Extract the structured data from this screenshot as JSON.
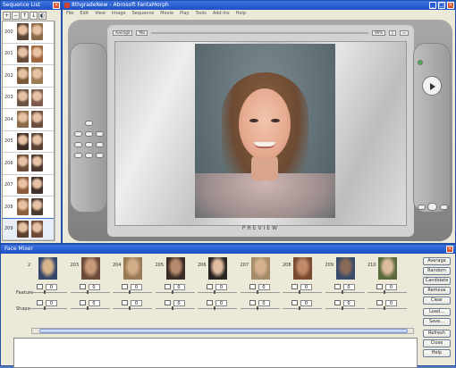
{
  "sequence_list": {
    "title": "Sequence List",
    "toolbar_buttons": [
      {
        "icon": "add-icon",
        "glyph": "+"
      },
      {
        "icon": "remove-icon",
        "glyph": "−"
      },
      {
        "icon": "move-up-icon",
        "glyph": "↑"
      },
      {
        "icon": "move-down-icon",
        "glyph": "↓"
      },
      {
        "icon": "sequence-settings-icon",
        "glyph": "◐"
      }
    ],
    "rows": [
      {
        "number": "200",
        "colors": [
          "#5b4636",
          "#8c6a4a"
        ]
      },
      {
        "number": "201",
        "colors": [
          "#6b4b3a",
          "#a0663d"
        ]
      },
      {
        "number": "202",
        "colors": [
          "#7a5a3b",
          "#9b7b55"
        ]
      },
      {
        "number": "203",
        "colors": [
          "#6b5343",
          "#7b5a49"
        ]
      },
      {
        "number": "204",
        "colors": [
          "#8a6a48",
          "#6c4d3c"
        ]
      },
      {
        "number": "205",
        "colors": [
          "#3b2c25",
          "#5b4435"
        ]
      },
      {
        "number": "206",
        "colors": [
          "#6c4e3a",
          "#4b3830"
        ]
      },
      {
        "number": "207",
        "colors": [
          "#8b5a3a",
          "#3f3029"
        ]
      },
      {
        "number": "208",
        "colors": [
          "#8a5e3f",
          "#4c3b33"
        ]
      },
      {
        "number": "209",
        "colors": [
          "#5b3f2f",
          "#6e4b38"
        ]
      }
    ]
  },
  "main_window": {
    "title": "8thgradeNew - Abrosoft FantaMorph",
    "menu": [
      "File",
      "Edit",
      "View",
      "Image",
      "Sequence",
      "Movie",
      "Play",
      "Tools",
      "Add-Ins",
      "Help"
    ],
    "screen_top": {
      "left_field": "Average",
      "mode": "Mix",
      "right_field": "90%"
    },
    "preview_label": "PREVIEW"
  },
  "face_mixer": {
    "title": "Face Mixer",
    "row_labels": {
      "feature": "Feature",
      "shape": "Shape"
    },
    "faces": [
      {
        "number": "2",
        "feature": "0",
        "shape": "0",
        "colors": [
          "#d8b58a",
          "#35466b"
        ]
      },
      {
        "number": "203",
        "feature": "0",
        "shape": "0",
        "colors": [
          "#c99a7a",
          "#6b4a3a"
        ]
      },
      {
        "number": "204",
        "feature": "0",
        "shape": "0",
        "colors": [
          "#d2ad88",
          "#9a7a55"
        ]
      },
      {
        "number": "205",
        "feature": "0",
        "shape": "0",
        "colors": [
          "#b68a6c",
          "#3b2c25"
        ]
      },
      {
        "number": "206",
        "feature": "0",
        "shape": "0",
        "colors": [
          "#e0bca0",
          "#272421"
        ]
      },
      {
        "number": "207",
        "feature": "0",
        "shape": "0",
        "colors": [
          "#d6b38e",
          "#a58b6a"
        ]
      },
      {
        "number": "208",
        "feature": "0",
        "shape": "0",
        "colors": [
          "#c08a6a",
          "#7a4a30"
        ]
      },
      {
        "number": "209",
        "feature": "0",
        "shape": "0",
        "colors": [
          "#8a6a58",
          "#3b4c6b"
        ]
      },
      {
        "number": "210",
        "feature": "0",
        "shape": "0",
        "colors": [
          "#dcbc9c",
          "#5a6b3b"
        ]
      }
    ],
    "buttons": [
      "Average",
      "Random",
      "Candidate",
      "Remove",
      "Clear",
      "Load...",
      "Save...",
      "Refresh",
      "Close",
      "Help"
    ]
  }
}
